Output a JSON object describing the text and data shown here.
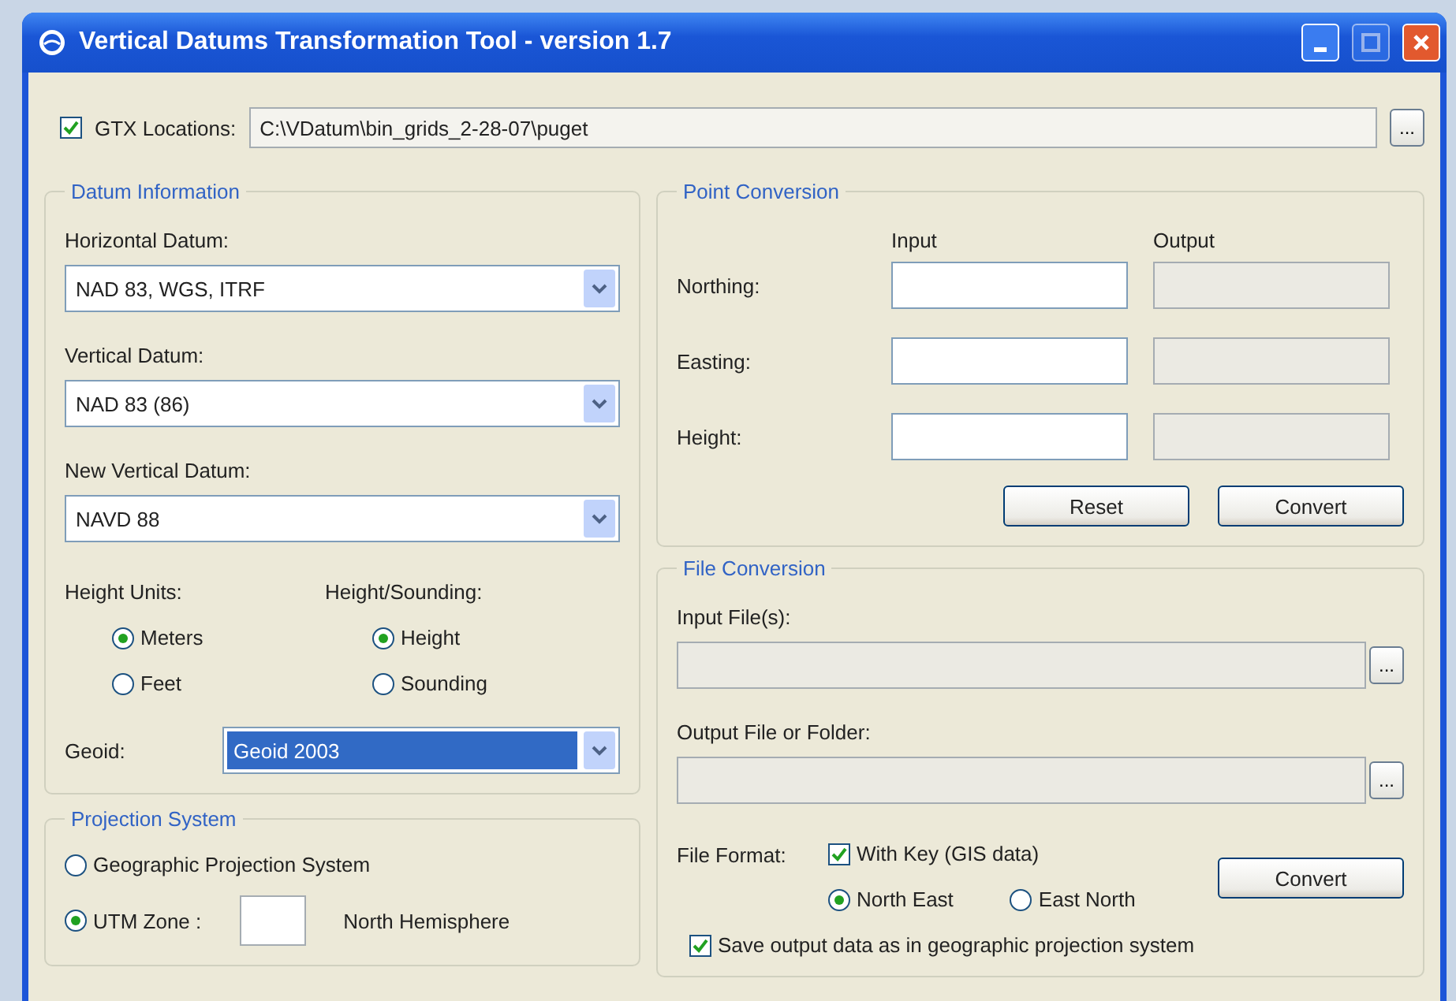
{
  "window": {
    "title": "Vertical Datums Transformation Tool - version 1.7"
  },
  "gtx": {
    "label": "GTX Locations:",
    "checked": true,
    "value": "C:\\VDatum\\bin_grids_2-28-07\\puget",
    "browse": "..."
  },
  "datum_information": {
    "title": "Datum Information",
    "fields": [
      {
        "label": "Horizontal Datum:",
        "value": "NAD 83, WGS, ITRF"
      },
      {
        "label": "Vertical Datum:",
        "value": "NAD 83 (86)"
      },
      {
        "label": "New Vertical Datum:",
        "value": "NAVD 88"
      }
    ],
    "height_units": {
      "label": "Height Units:",
      "options": [
        {
          "label": "Meters",
          "selected": true
        },
        {
          "label": "Feet",
          "selected": false
        }
      ]
    },
    "height_sounding": {
      "label": "Height/Sounding:",
      "options": [
        {
          "label": "Height",
          "selected": true
        },
        {
          "label": "Sounding",
          "selected": false
        }
      ]
    },
    "geoid": {
      "label": "Geoid:",
      "value": "Geoid 2003",
      "highlighted": true
    }
  },
  "projection_system": {
    "title": "Projection System",
    "options": [
      {
        "label": "Geographic Projection System",
        "selected": false
      },
      {
        "label": "UTM Zone :",
        "selected": true
      }
    ],
    "hemisphere": "North Hemisphere"
  },
  "point_conversion": {
    "title": "Point Conversion",
    "input_header": "Input",
    "output_header": "Output",
    "rows": [
      {
        "label": "Northing:"
      },
      {
        "label": "Easting:"
      },
      {
        "label": "Height:"
      }
    ],
    "buttons": [
      "Reset",
      "Convert"
    ]
  },
  "file_conversion": {
    "title": "File Conversion",
    "input_label": "Input File(s):",
    "input_browse": "...",
    "output_label": "Output File or Folder:",
    "output_browse": "...",
    "format_label": "File Format:",
    "with_key": {
      "label": "With Key (GIS data)",
      "checked": true
    },
    "order": [
      {
        "label": "North East",
        "selected": true
      },
      {
        "label": "East North",
        "selected": false
      }
    ],
    "convert": "Convert",
    "save_geographic": {
      "label": "Save output data as in geographic projection system",
      "checked": true
    }
  }
}
